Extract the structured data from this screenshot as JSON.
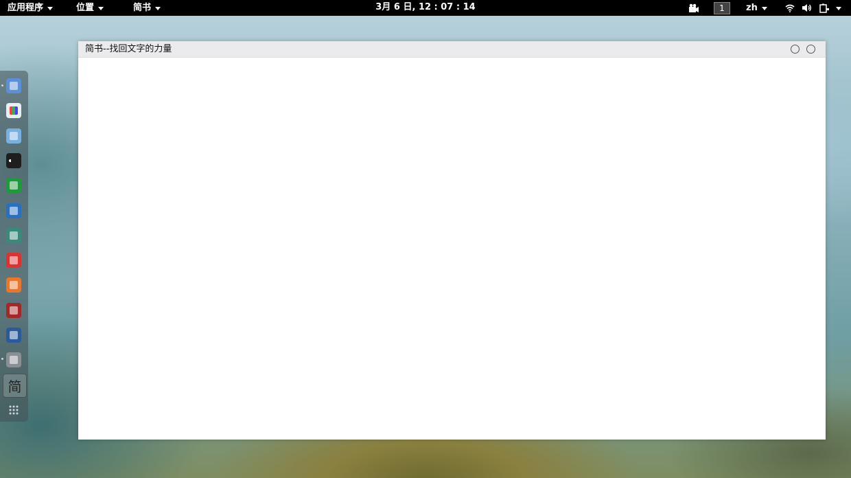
{
  "top_panel": {
    "applications_label": "应用程序",
    "places_label": "位置",
    "app_menu_label": "简书",
    "clock": "3月  6 日, 12 : 07 : 14",
    "workspace": "1",
    "input_method": "zh"
  },
  "dock": {
    "items": [
      {
        "name": "files",
        "icon": "folder-icon",
        "color": "#5b8fd6"
      },
      {
        "name": "software-center",
        "icon": "app-grid-icon",
        "color": "#e9eef2"
      },
      {
        "name": "zoomit",
        "icon": "mascot-icon",
        "color": "#7ab0e0"
      },
      {
        "name": "terminal",
        "icon": "terminal-icon",
        "color": "#1e1e1e"
      },
      {
        "name": "vim",
        "icon": "vim-icon",
        "color": "#1f9a3a"
      },
      {
        "name": "metasploit",
        "icon": "m-shield-icon",
        "color": "#2a6fc0"
      },
      {
        "name": "character-app",
        "icon": "avatar-icon",
        "color": "#3a8a7a"
      },
      {
        "name": "xmind",
        "icon": "xmind-icon",
        "color": "#e03030"
      },
      {
        "name": "burpsuite",
        "icon": "lightning-icon",
        "color": "#e8762b"
      },
      {
        "name": "faraday",
        "icon": "circles-icon",
        "color": "#a42828"
      },
      {
        "name": "wireshark",
        "icon": "shark-icon",
        "color": "#2a5a9a"
      },
      {
        "name": "settings",
        "icon": "gear-icon",
        "color": "#8a8f94"
      }
    ],
    "active_app_glyph": "简",
    "show_apps_icon": "grid-dots-icon"
  },
  "window": {
    "title": "简书--找回文字的力量"
  }
}
